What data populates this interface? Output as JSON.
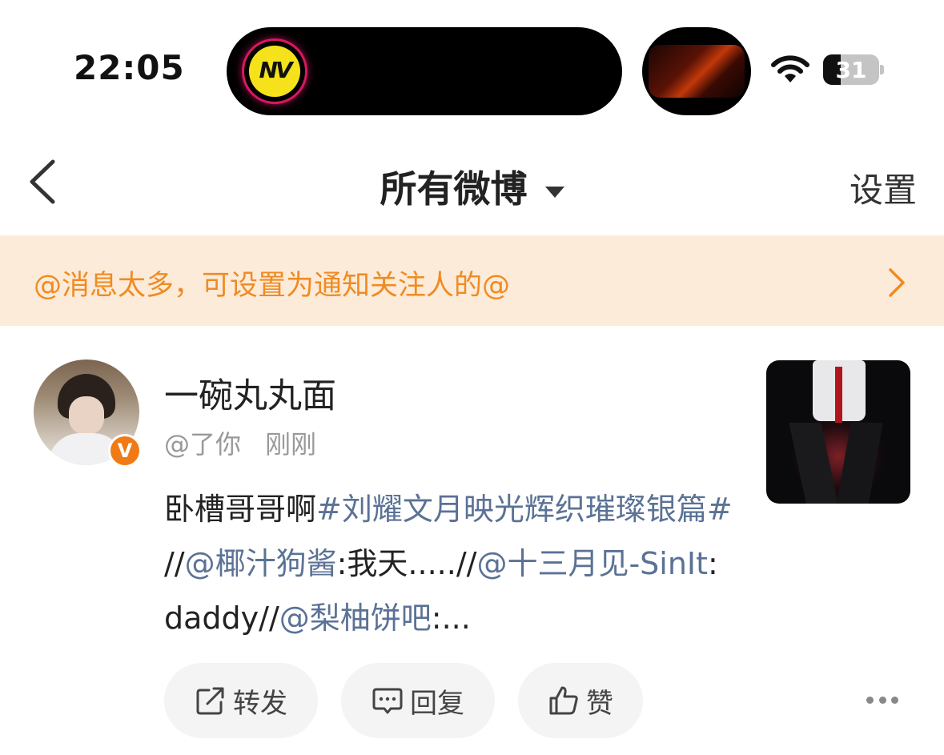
{
  "status_bar": {
    "time": "22:05",
    "battery": "31",
    "island_app_label": "NV"
  },
  "nav": {
    "title": "所有微博",
    "settings": "设置"
  },
  "banner": {
    "text": "@消息太多，可设置为通知关注人的@"
  },
  "post": {
    "username": "一碗丸丸面",
    "handle": "@了你",
    "time": "刚刚",
    "verified_badge": "V",
    "text_plain_1": "卧槽哥哥啊",
    "hashtag": "#刘耀文月映光辉织璀璨银篇#",
    "text_plain_2": " //",
    "mention_1": "@椰汁狗酱",
    "text_plain_3": ":我天.....//",
    "mention_2": "@十三月见-SinIt",
    "text_plain_4": ":daddy//",
    "mention_3": "@梨柚饼吧",
    "text_plain_5": ":..."
  },
  "actions": {
    "forward": "转发",
    "reply": "回复",
    "like": "赞"
  },
  "icons": {
    "back": "chevron-left-icon",
    "caret": "caret-down-icon",
    "banner_arrow": "chevron-right-icon",
    "forward": "share-icon",
    "reply": "comment-icon",
    "like": "thumbs-up-icon",
    "more": "more-icon",
    "wifi": "wifi-icon"
  },
  "colors": {
    "banner_bg": "#fdebd9",
    "banner_text": "#f08b22",
    "link": "#5b7295",
    "badge": "#f07a16"
  }
}
